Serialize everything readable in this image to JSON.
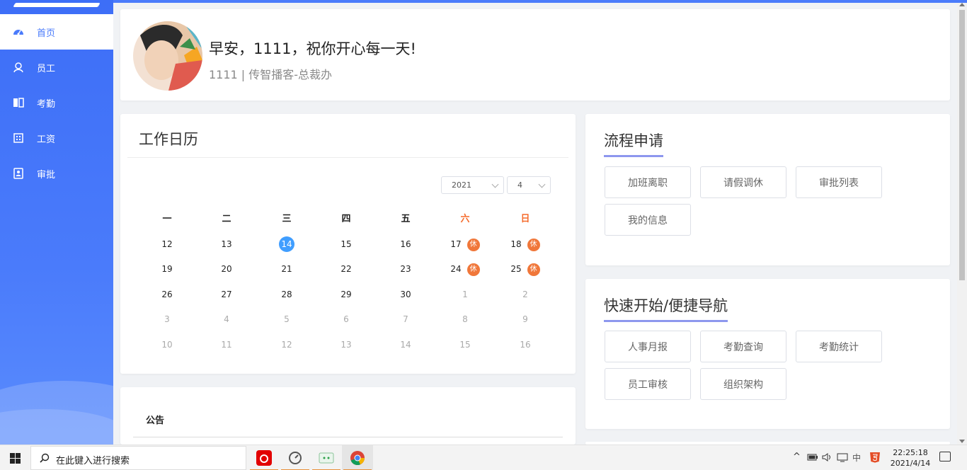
{
  "sidebar": {
    "items": [
      {
        "label": "首页",
        "icon": "dashboard-icon"
      },
      {
        "label": "员工",
        "icon": "user-icon"
      },
      {
        "label": "考勤",
        "icon": "book-icon"
      },
      {
        "label": "工资",
        "icon": "calculator-icon"
      },
      {
        "label": "审批",
        "icon": "id-card-icon"
      }
    ]
  },
  "welcome": {
    "greeting": "早安，1111，祝你开心每一天!",
    "subtitle": "1111 | 传智播客-总裁办"
  },
  "calendar": {
    "title": "工作日历",
    "year": "2021",
    "month": "4",
    "weekdays": [
      "一",
      "二",
      "三",
      "四",
      "五",
      "六",
      "日"
    ],
    "rest_label": "休",
    "weeks": [
      [
        "12",
        "13",
        "14",
        "15",
        "16",
        "17",
        "18"
      ],
      [
        "19",
        "20",
        "21",
        "22",
        "23",
        "24",
        "25"
      ],
      [
        "26",
        "27",
        "28",
        "29",
        "30",
        "1",
        "2"
      ],
      [
        "3",
        "4",
        "5",
        "6",
        "7",
        "8",
        "9"
      ],
      [
        "10",
        "11",
        "12",
        "13",
        "14",
        "15",
        "16"
      ]
    ]
  },
  "notice": {
    "title": "公告"
  },
  "flow": {
    "title": "流程申请",
    "buttons": [
      "加班离职",
      "请假调休",
      "审批列表",
      "我的信息"
    ]
  },
  "quick": {
    "title": "快速开始/便捷导航",
    "buttons": [
      "人事月报",
      "考勤查询",
      "考勤统计",
      "员工审核",
      "组织架构"
    ]
  },
  "taskbar": {
    "search_placeholder": "在此键入进行搜索",
    "ime": "中",
    "time": "22:25:18",
    "date": "2021/4/14"
  }
}
